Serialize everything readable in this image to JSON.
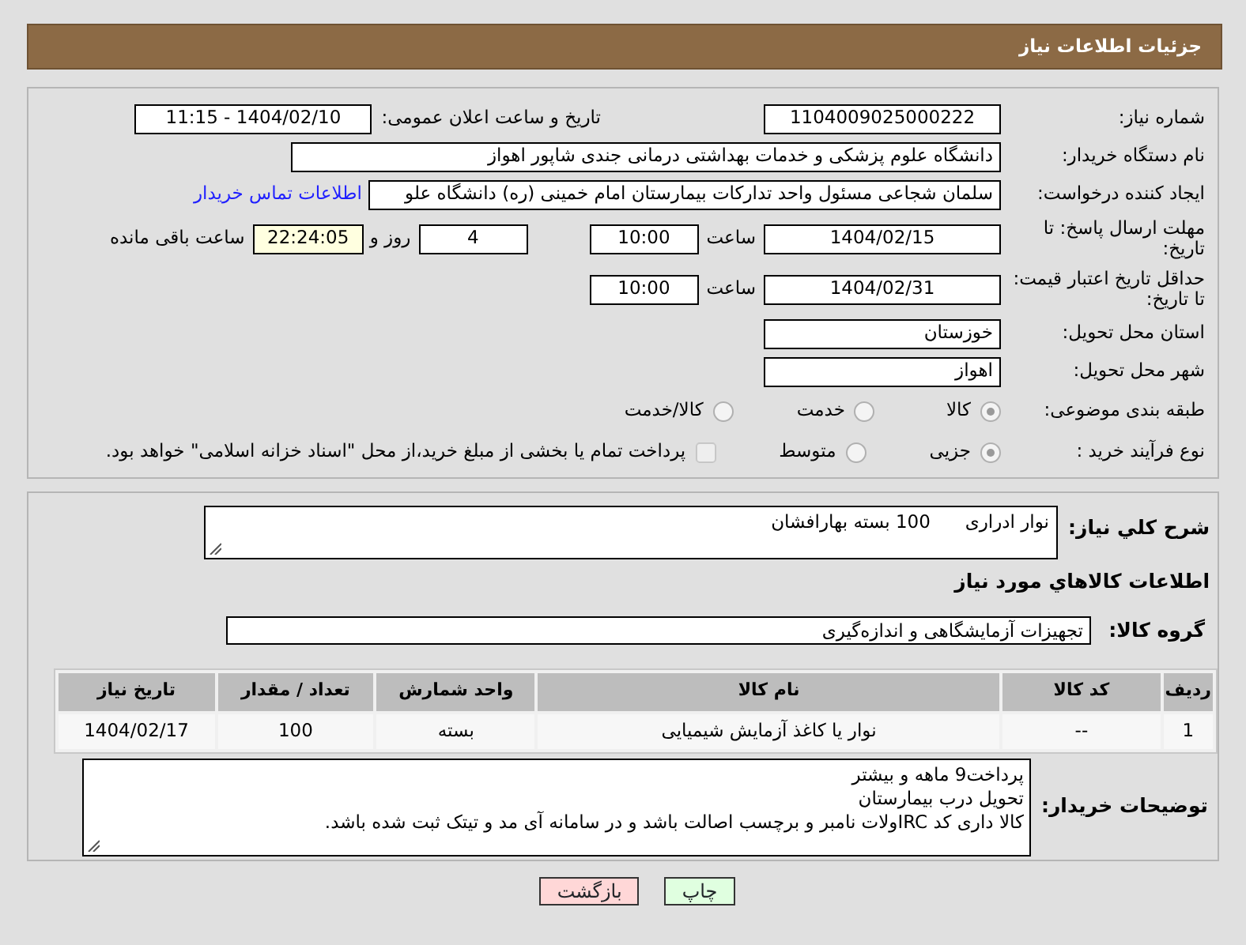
{
  "header": {
    "title": "جزئیات اطلاعات نیاز"
  },
  "need_number": {
    "label": "شماره نیاز:",
    "value": "1104009025000222"
  },
  "announce": {
    "label": "تاریخ و ساعت اعلان عمومی:",
    "value": "1404/02/10 - 11:15"
  },
  "buyer_org": {
    "label": "نام دستگاه خریدار:",
    "value": "دانشگاه علوم پزشکی و خدمات بهداشتی درمانی جندی شاپور اهواز"
  },
  "requester": {
    "label": "ایجاد کننده درخواست:",
    "value": "سلمان شجاعی مسئول واحد تدارکات بیمارستان امام خمینی (ره) دانشگاه علو",
    "link": "اطلاعات تماس خریدار"
  },
  "reply_deadline": {
    "label": "مهلت ارسال پاسخ: تا تاریخ:",
    "date": "1404/02/15",
    "time_label": "ساعت",
    "time": "10:00",
    "days": "4",
    "days_label": "روز و",
    "remaining": "22:24:05",
    "remaining_label": "ساعت باقی مانده"
  },
  "price_validity": {
    "label": "حداقل تاریخ اعتبار قیمت: تا تاریخ:",
    "date": "1404/02/31",
    "time_label": "ساعت",
    "time": "10:00"
  },
  "province": {
    "label": "استان محل تحویل:",
    "value": "خوزستان"
  },
  "city": {
    "label": "شهر محل تحویل:",
    "value": "اهواز"
  },
  "category": {
    "label": "طبقه بندی موضوعی:",
    "options": [
      {
        "label": "کالا",
        "selected": true
      },
      {
        "label": "خدمت",
        "selected": false
      },
      {
        "label": "کالا/خدمت",
        "selected": false
      }
    ]
  },
  "process": {
    "label": "نوع فرآیند خرید :",
    "options": [
      {
        "label": "جزیی",
        "selected": true
      },
      {
        "label": "متوسط",
        "selected": false
      }
    ],
    "treasury": {
      "label": "پرداخت تمام یا بخشی از مبلغ خرید،از محل \"اسناد خزانه اسلامی\" خواهد بود.",
      "checked": false
    }
  },
  "description": {
    "label": "شرح کلي نياز:",
    "value": "نوار ادراری      100 بسته بهارافشان"
  },
  "goods_heading": "اطلاعات کالاهاي مورد نياز",
  "goods_group": {
    "label": "گروه کالا:",
    "value": "تجهیزات آزمایشگاهی و اندازه‌گیری"
  },
  "table": {
    "columns": [
      "ردیف",
      "کد کالا",
      "نام کالا",
      "واحد شمارش",
      "تعداد / مقدار",
      "تاریخ نیاز"
    ],
    "rows": [
      [
        "1",
        "--",
        "نوار یا کاغذ آزمایش شیمیایی",
        "بسته",
        "100",
        "1404/02/17"
      ]
    ]
  },
  "buyer_notes": {
    "label": "توضیحات خریدار:",
    "lines": [
      "پرداخت9 ماهه و بیشتر",
      "تحویل درب بیمارستان",
      "کالا داری کد IRCولات نامبر و برچسب اصالت باشد و در سامانه آی مد و تیتک ثبت شده باشد."
    ]
  },
  "buttons": [
    {
      "label": "چاپ",
      "kind": "print"
    },
    {
      "label": "بازگشت",
      "kind": "back"
    }
  ]
}
